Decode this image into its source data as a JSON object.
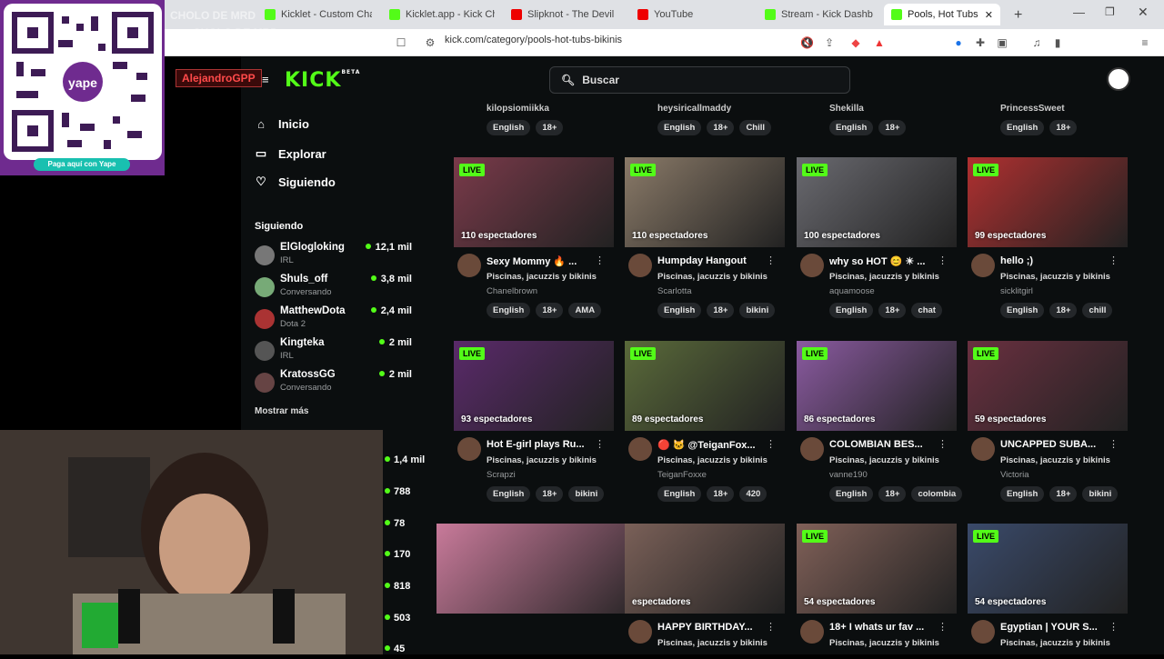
{
  "browser": {
    "tabs": [
      {
        "label": "Kicklet - Custom Cha",
        "active": false
      },
      {
        "label": "Kicklet.app - Kick Chatb",
        "active": false
      },
      {
        "label": "Slipknot - The Devil",
        "active": false
      },
      {
        "label": "YouTube",
        "active": false
      },
      {
        "label": "Stream - Kick Dashb",
        "active": false
      },
      {
        "label": "Pools, Hot Tubs",
        "active": true
      }
    ],
    "url": "kick.com/category/pools-hot-tubs-bikinis"
  },
  "kick": {
    "logo": "KICK",
    "logo_badge": "BETA",
    "search_placeholder": "Buscar",
    "nav": [
      {
        "label": "Inicio",
        "icon": "home-icon"
      },
      {
        "label": "Explorar",
        "icon": "compass-icon"
      },
      {
        "label": "Siguiendo",
        "icon": "heart-icon"
      }
    ],
    "following_title": "Siguiendo",
    "following": [
      {
        "name": "ElGlogloking",
        "category": "IRL",
        "viewers": "12,1 mil"
      },
      {
        "name": "Shuls_off",
        "category": "Conversando",
        "viewers": "3,8 mil"
      },
      {
        "name": "MatthewDota",
        "category": "Dota 2",
        "viewers": "2,4 mil"
      },
      {
        "name": "Kingteka",
        "category": "IRL",
        "viewers": "2 mil"
      },
      {
        "name": "KratossGG",
        "category": "Conversando",
        "viewers": "2 mil"
      }
    ],
    "show_more": "Mostrar más",
    "top_row": [
      {
        "streamer": "kilopsiomiikka",
        "tags": [
          "English",
          "18+"
        ]
      },
      {
        "streamer": "heysiricallmaddy",
        "tags": [
          "English",
          "18+",
          "Chill"
        ]
      },
      {
        "streamer": "Shekilla",
        "tags": [
          "English",
          "18+"
        ]
      },
      {
        "streamer": "PrincessSweet",
        "tags": [
          "English",
          "18+"
        ]
      }
    ],
    "live_label": "LIVE",
    "category": "Piscinas, jacuzzis y bikinis",
    "cards": [
      {
        "views": "110 espectadores",
        "title": "Sexy Mommy 🔥 ...",
        "streamer": "Chanelbrown",
        "tags": [
          "English",
          "18+",
          "AMA"
        ],
        "color": "#7a3a4a"
      },
      {
        "views": "110 espectadores",
        "title": "Humpday Hangout",
        "streamer": "Scarlotta",
        "tags": [
          "English",
          "18+",
          "bikini"
        ],
        "color": "#8a7a68"
      },
      {
        "views": "100 espectadores",
        "title": "why so HOT 😊 ☀ ...",
        "streamer": "aquamoose",
        "tags": [
          "English",
          "18+",
          "chat"
        ],
        "color": "#6a6a70"
      },
      {
        "views": "99 espectadores",
        "title": "hello ;)",
        "streamer": "sicklitgirl",
        "tags": [
          "English",
          "18+",
          "chill"
        ],
        "color": "#b03030"
      },
      {
        "views": "93 espectadores",
        "title": "Hot E-girl plays Ru...",
        "streamer": "Scrapzi",
        "tags": [
          "English",
          "18+",
          "bikini"
        ],
        "color": "#5a2a6a"
      },
      {
        "views": "89 espectadores",
        "title": "🔴 🐱 @TeiganFox...",
        "streamer": "TeiganFoxxe",
        "tags": [
          "English",
          "18+",
          "420"
        ],
        "color": "#5a6a3a"
      },
      {
        "views": "86 espectadores",
        "title": "COLOMBIAN BES...",
        "streamer": "vanne190",
        "tags": [
          "English",
          "18+",
          "colombia"
        ],
        "color": "#8a5aa0"
      },
      {
        "views": "59 espectadores",
        "title": "UNCAPPED SUBA...",
        "streamer": "Victoria",
        "tags": [
          "English",
          "18+",
          "bikini"
        ],
        "color": "#6a3040"
      },
      {
        "views": "",
        "title": "",
        "streamer": "",
        "tags": [],
        "color": "#c87a9a"
      },
      {
        "views": "espectadores",
        "title": "HAPPY BIRTHDAY...",
        "streamer": "",
        "tags": [],
        "color": "#7a6058"
      },
      {
        "views": "54 espectadores",
        "title": "18+ I whats ur fav ...",
        "streamer": "",
        "tags": [],
        "color": "#806058"
      },
      {
        "views": "54 espectadores",
        "title": "Egyptian | YOUR S...",
        "streamer": "",
        "tags": [],
        "color": "#3a4a6a"
      }
    ]
  },
  "overlay": {
    "qr_button": "Paga aquí con Yape",
    "qr_brand": "yape",
    "chat_names": [
      "CHOLO DE MRD",
      "CHOLO DE MRD",
      "CHOLO DE MRD",
      "CHOLO DE MRD"
    ],
    "alert_user": "AlejandroGPP",
    "webcam_side_counts": [
      "1,4 mil",
      "788",
      "78",
      "170",
      "818",
      "503",
      "45"
    ]
  }
}
